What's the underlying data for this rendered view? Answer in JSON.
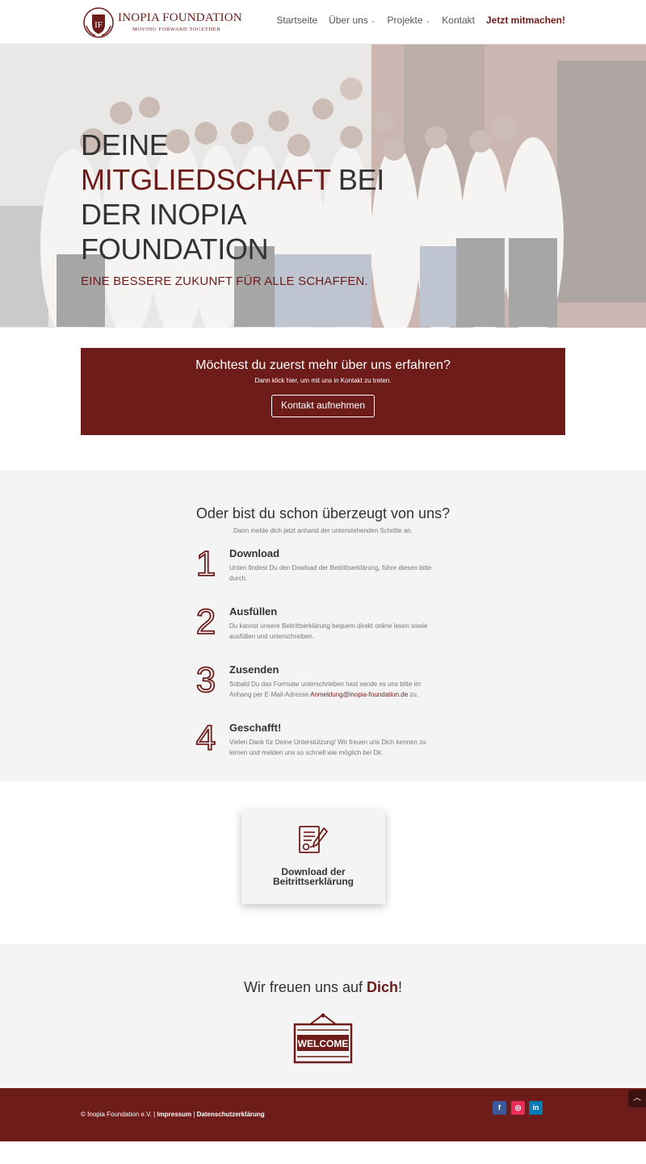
{
  "header": {
    "logo_title": "INOPIA FOUNDATION",
    "logo_subtitle": "MOVING FORWARD TOGETHER",
    "nav": [
      {
        "label": "Startseite"
      },
      {
        "label": "Über uns",
        "has_dropdown": true
      },
      {
        "label": "Projekte",
        "has_dropdown": true
      },
      {
        "label": "Kontakt"
      },
      {
        "label": "Jetzt mitmachen!",
        "highlight": true
      }
    ]
  },
  "hero": {
    "title_line1": "Deine",
    "title_accent": "Mitgliedschaft",
    "title_rest": " bei der Inopia Foundation",
    "subtitle": "Eine bessere Zukunft für alle schaffen."
  },
  "contact_box": {
    "title": "Möchtest du zuerst mehr über uns erfahren?",
    "text": "Dann klick hier, um mit uns in Kontakt zu treten.",
    "button": "Kontakt aufnehmen"
  },
  "steps_section": {
    "title": "Oder bist du schon überzeugt von uns?",
    "subtitle": "Dann melde dich jetzt anhand der untenstehenden Schritte an.",
    "steps": [
      {
        "number": "1",
        "title": "Download",
        "text": "Unten findest Du den Dowload der Beitrittserklärung, führe diesen bitte durch."
      },
      {
        "number": "2",
        "title": "Ausfüllen",
        "text": "Du kannst unsere Beitrittserklärung bequem direkt online lesen sowie ausfüllen und unterschreiben."
      },
      {
        "number": "3",
        "title": "Zusenden",
        "text_before": "Sobald Du das Formular unterschrieben hast sende es uns bitte im Anhang per E-Mail-Adresse ",
        "email": "Anmeldung@inopia-foundation.de",
        "text_after": " zu."
      },
      {
        "number": "4",
        "title": "Geschafft!",
        "text": "Vielen Dank für Deine Unterstützung! Wir freuen uns Dich kennen zu lernen und melden uns so schnell wie möglich bei Dir."
      }
    ]
  },
  "download_card": {
    "label_line1": "Download der",
    "label_line2": "Beitrittserklärung",
    "icon": "document-signature-icon"
  },
  "welcome": {
    "title_before": "Wir freuen uns auf ",
    "title_em": "Dich",
    "title_after": "!",
    "sign_text": "WELCOME"
  },
  "footer": {
    "copyright": "© Inopia Foundation e.V. | ",
    "impressum": "Impressum",
    "separator": " | ",
    "datenschutz": "Datenschutzerklärung",
    "social": [
      {
        "name": "facebook",
        "glyph": "f"
      },
      {
        "name": "instagram",
        "glyph": "◎"
      },
      {
        "name": "linkedin",
        "glyph": "in"
      }
    ],
    "scroll_top_glyph": "︿"
  },
  "colors": {
    "brand": "#6e1c1a",
    "background_light": "#f4f4f4",
    "text": "#333333"
  }
}
